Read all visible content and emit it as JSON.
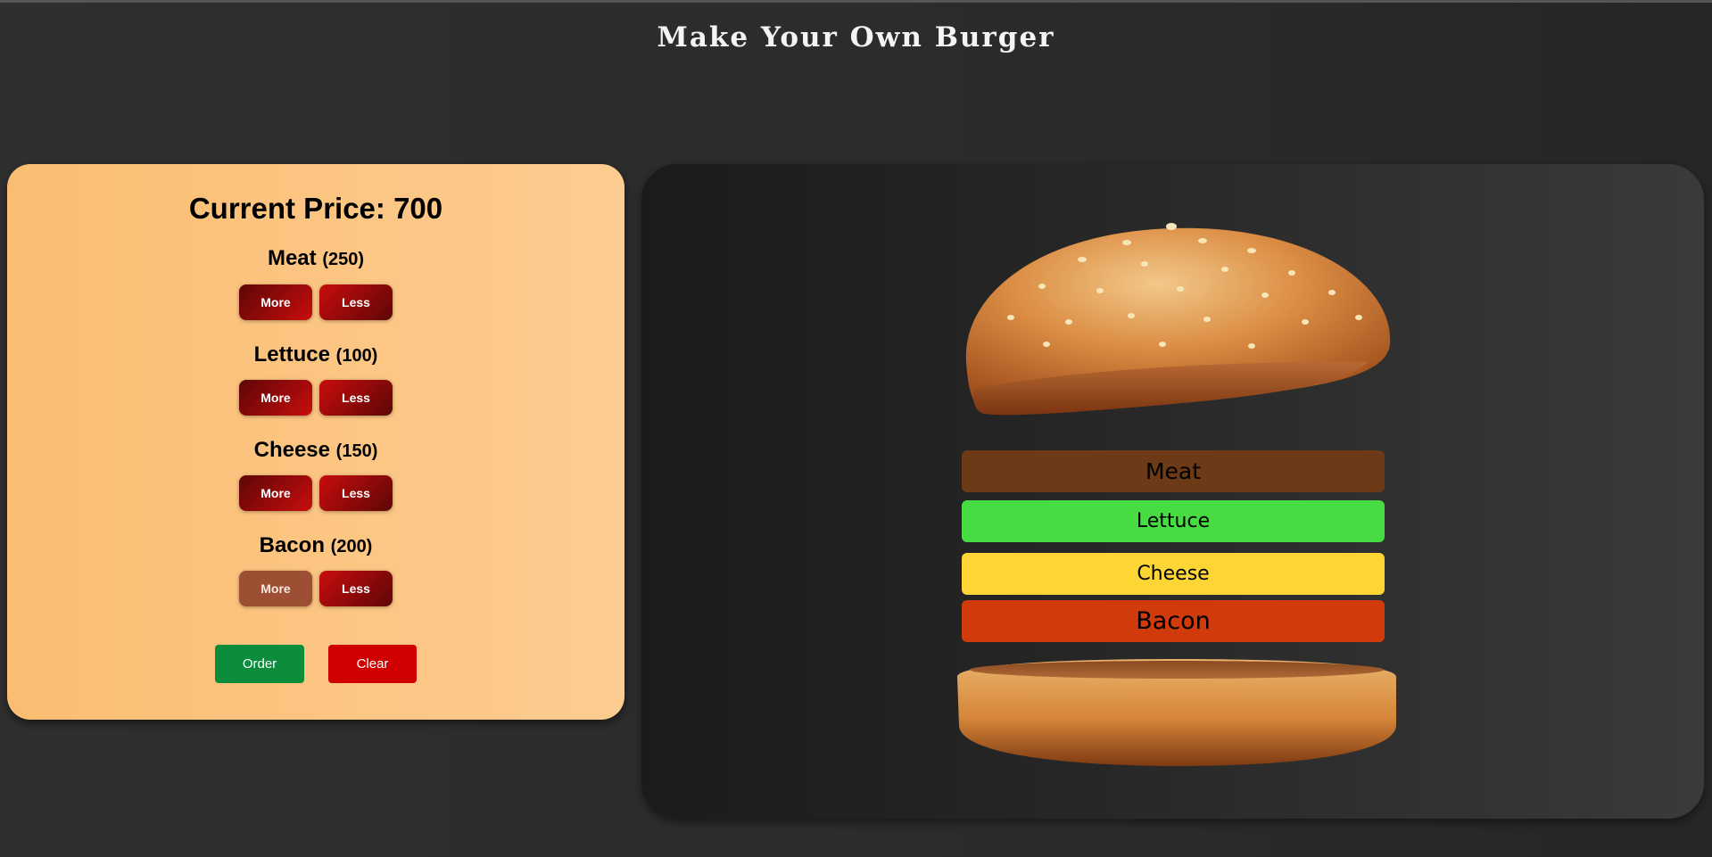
{
  "header": {
    "title": "Make Your Own Burger"
  },
  "controls": {
    "price_text": "Current Price: 700",
    "ingredients": [
      {
        "name": "Meat",
        "price": "(250)",
        "more_label": "More",
        "less_label": "Less"
      },
      {
        "name": "Lettuce",
        "price": "(100)",
        "more_label": "More",
        "less_label": "Less"
      },
      {
        "name": "Cheese",
        "price": "(150)",
        "more_label": "More",
        "less_label": "Less"
      },
      {
        "name": "Bacon",
        "price": "(200)",
        "more_label": "More",
        "less_label": "Less"
      }
    ],
    "order_label": "Order",
    "clear_label": "Clear"
  },
  "burger": {
    "layers": [
      "Meat",
      "Lettuce",
      "Cheese",
      "Bacon"
    ]
  },
  "colors": {
    "meat": "#6c3a16",
    "lettuce": "#47dc41",
    "cheese": "#fdd535",
    "bacon": "#d13a0b",
    "order": "#0c8d3c",
    "clear": "#d10000"
  }
}
